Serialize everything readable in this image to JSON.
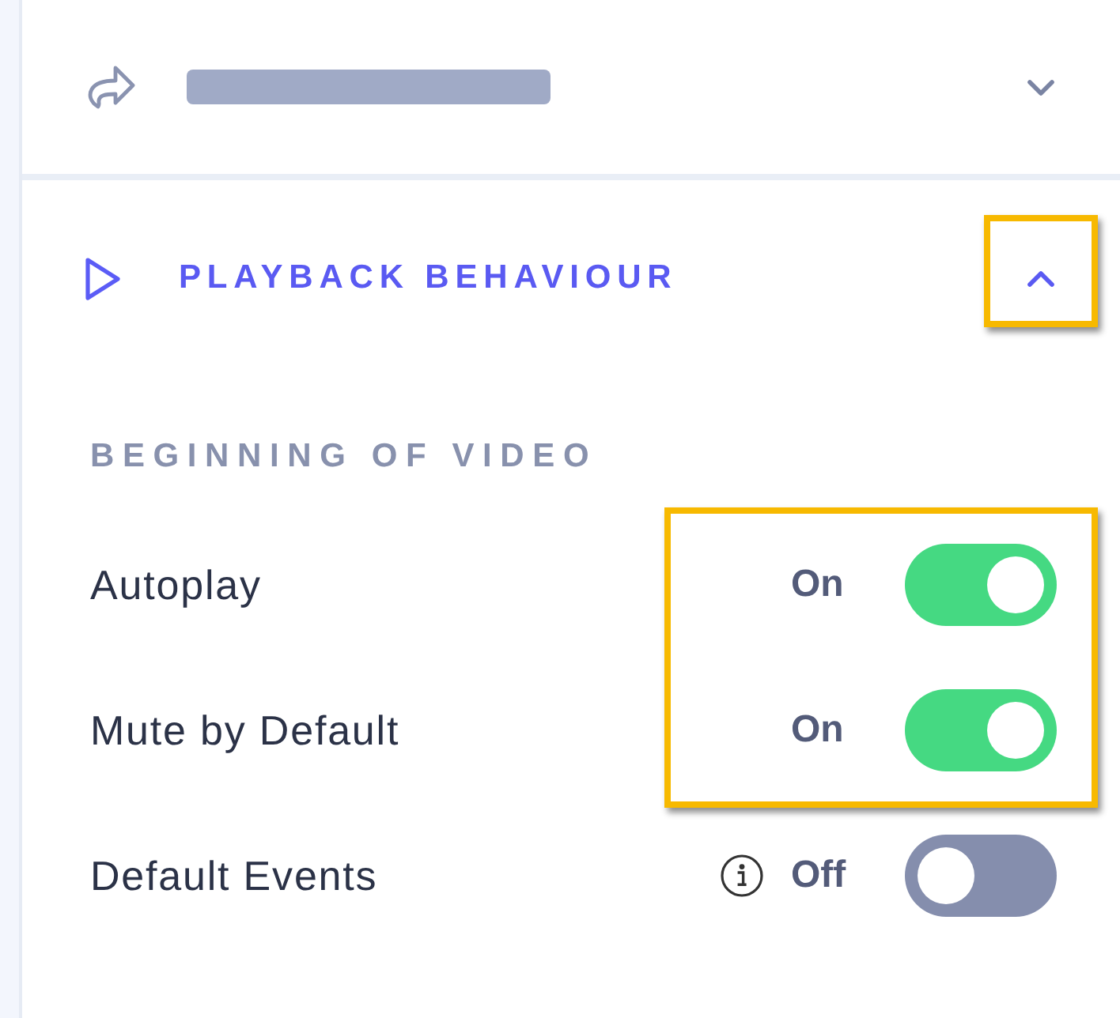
{
  "sections": [
    {
      "kind": "redacted",
      "expanded": false,
      "highlighted": false
    },
    {
      "kind": "titled",
      "title": "PLAYBACK BEHAVIOUR",
      "expanded": true,
      "highlighted": true,
      "group_heading": "BEGINNING OF VIDEO",
      "settings": [
        {
          "label": "Autoplay",
          "info": false,
          "state_text": "On",
          "on": true,
          "highlighted": true
        },
        {
          "label": "Mute by Default",
          "info": false,
          "state_text": "On",
          "on": true,
          "highlighted": true
        },
        {
          "label": "Default Events",
          "info": true,
          "state_text": "Off",
          "on": false,
          "highlighted": false
        }
      ]
    }
  ]
}
